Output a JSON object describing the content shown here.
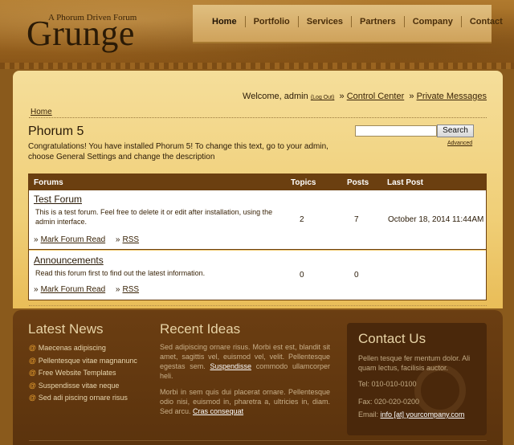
{
  "header": {
    "tagline": "A Phorum Driven Forum",
    "logo": "Grunge",
    "nav": [
      "Home",
      "Portfolio",
      "Services",
      "Partners",
      "Company",
      "Contact"
    ]
  },
  "user_bar": {
    "welcome": "Welcome, admin",
    "logout": "(Log Out)",
    "control_center": "Control Center",
    "private_messages": "Private Messages",
    "separator": "»"
  },
  "breadcrumb": {
    "home": "Home"
  },
  "forum": {
    "title": "Phorum 5",
    "intro": "Congratulations! You have installed Phorum 5! To change this text, go to your admin, choose General Settings and change the description"
  },
  "search": {
    "button": "Search",
    "advanced": "Advanced",
    "placeholder": ""
  },
  "table": {
    "headers": {
      "forums": "Forums",
      "topics": "Topics",
      "posts": "Posts",
      "last_post": "Last Post"
    },
    "rows": [
      {
        "name": "Test Forum",
        "description": "This is a test forum. Feel free to delete it or edit after installation, using the admin interface.",
        "topics": "2",
        "posts": "7",
        "last_post": "October 18, 2014 11:44AM",
        "mark_read": "Mark Forum Read",
        "rss": "RSS"
      },
      {
        "name": "Announcements",
        "description": "Read this forum first to find out the latest information.",
        "topics": "0",
        "posts": "0",
        "last_post": "",
        "mark_read": "Mark Forum Read",
        "rss": "RSS"
      }
    ]
  },
  "footer": {
    "news": {
      "heading": "Latest News",
      "items": [
        "Maecenas adipiscing",
        "Pellentesque vitae magnanunc",
        "Free Website Templates",
        "Suspendisse vitae neque",
        "Sed adi piscing ornare risus"
      ],
      "bullet": "@"
    },
    "ideas": {
      "heading": "Recent Ideas",
      "p1_text": "Sed adipiscing ornare risus. Morbi est est, blandit sit amet, sagittis vel, euismod vel, velit. Pellentesque egestas sem.",
      "p1_link": "Suspendisse",
      "p1_tail": "commodo ullamcorper heli.",
      "p2_text": "Morbi in sem quis dui placerat ornare. Pellentesque odio nisi, euismod in, pharetra a, ultricies in, diam. Sed arcu.",
      "p2_link": "Cras consequat"
    },
    "contact": {
      "heading": "Contact Us",
      "text": "Pellen tesque fer mentum dolor. Ali quam lectus, facilisis auctor.",
      "tel": "Tel: 010-010-0100",
      "fax": "Fax: 020-020-0200",
      "email_label": "Email:",
      "email": "info [at] yourcompany.com"
    }
  },
  "colors": {
    "accent": "#6b3f10",
    "panel": "#f0cf78",
    "footer": "#5b330d",
    "bullet": "#e09a2e"
  }
}
